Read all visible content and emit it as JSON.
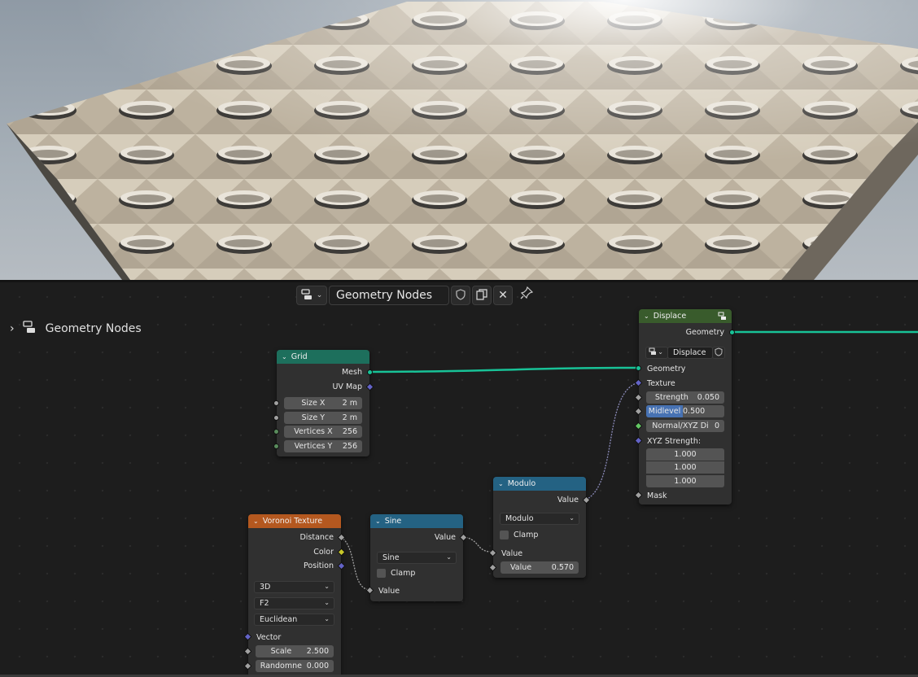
{
  "editor_header": {
    "tree_name": "Geometry Nodes",
    "tree_type_icon": "node-tree-icon",
    "fake_user_icon": "shield-icon",
    "duplicate_icon": "duplicate-icon",
    "unlink_icon": "close-icon",
    "pin_icon": "pin-icon"
  },
  "breadcrumb": {
    "label": "Geometry Nodes"
  },
  "colors": {
    "geometry_socket": "#18c297",
    "vector_socket": "#6363c7",
    "color_socket": "#c7c729",
    "float_socket": "#a1a1a1",
    "grid_header": "#1d6f5c",
    "texture_header": "#b4581f",
    "math_header": "#246283",
    "displace_header": "#395b2c",
    "highlight": "#4772b3"
  },
  "nodes": {
    "grid": {
      "title": "Grid",
      "outputs": [
        "Mesh",
        "UV Map"
      ],
      "inputs": [
        {
          "label": "Size X",
          "value": "2 m"
        },
        {
          "label": "Size Y",
          "value": "2 m"
        },
        {
          "label": "Vertices X",
          "value": "256"
        },
        {
          "label": "Vertices Y",
          "value": "256"
        }
      ]
    },
    "voronoi": {
      "title": "Voronoi Texture",
      "outputs": [
        "Distance",
        "Color",
        "Position"
      ],
      "dimensions": "3D",
      "feature": "F2",
      "metric": "Euclidean",
      "vector_label": "Vector",
      "inputs": [
        {
          "label": "Scale",
          "value": "2.500"
        },
        {
          "label": "Randomne",
          "value": "0.000"
        }
      ]
    },
    "sine": {
      "title": "Sine",
      "output": "Value",
      "operation": "Sine",
      "clamp": "Clamp",
      "input": "Value"
    },
    "modulo": {
      "title": "Modulo",
      "output": "Value",
      "operation": "Modulo",
      "clamp": "Clamp",
      "input_a": "Value",
      "input_b": {
        "label": "Value",
        "value": "0.570"
      }
    },
    "displace": {
      "title": "Displace",
      "output": "Geometry",
      "texture_name": "Displace",
      "in_geometry": "Geometry",
      "in_texture": "Texture",
      "strength": {
        "label": "Strength",
        "value": "0.050"
      },
      "midlevel": {
        "label": "Midlevel",
        "value": "0.500"
      },
      "normal": {
        "label": "Normal/XYZ Di",
        "value": "0"
      },
      "xyz_label": "XYZ Strength:",
      "xyz": [
        "1.000",
        "1.000",
        "1.000"
      ],
      "mask": "Mask"
    }
  }
}
